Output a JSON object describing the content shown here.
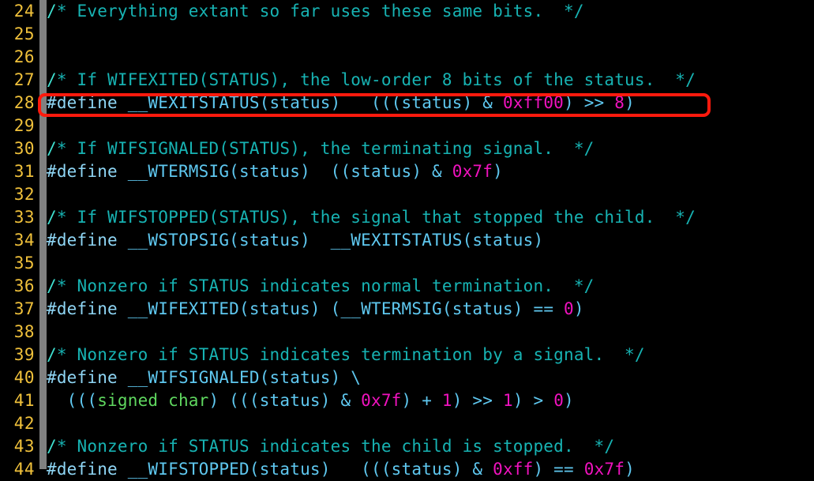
{
  "editor": {
    "background_color": "#000000",
    "gutter_bar_color": "#808080",
    "lineno_color": "#f0c13b",
    "comment_color": "#17b3b3",
    "identifier_color": "#5fc8f0",
    "number_color": "#f012be",
    "type_color": "#5fd75f",
    "preproc_color": "#8fd6f5",
    "highlight_color": "#ff1a0d"
  },
  "highlight": {
    "line_number": "28",
    "text": "#define __WEXITSTATUS(status)   (((status) & 0xff00) >> 8)"
  },
  "lines": [
    {
      "number": "24",
      "text": "/* Everything extant so far uses these same bits.  */",
      "tokens": [
        {
          "t": "/",
          "c": "tok-slash"
        },
        {
          "t": "* Everything extant so far uses these same bits.  */",
          "c": "tok-comment"
        }
      ]
    },
    {
      "number": "25",
      "text": "",
      "tokens": []
    },
    {
      "number": "26",
      "text": "",
      "tokens": []
    },
    {
      "number": "27",
      "text": "/* If WIFEXITED(STATUS), the low-order 8 bits of the status.  */",
      "tokens": [
        {
          "t": "/",
          "c": "tok-slash"
        },
        {
          "t": "* If WIFEXITED(STATUS), the low-order 8 bits of the status.  */",
          "c": "tok-comment"
        }
      ]
    },
    {
      "number": "28",
      "text": "#define __WEXITSTATUS(status)   (((status) & 0xff00) >> 8)",
      "tokens": [
        {
          "t": "#define",
          "c": "tok-pre"
        },
        {
          "t": " __WEXITSTATUS(status)   (((status) & ",
          "c": "tok-ident"
        },
        {
          "t": "0xff00",
          "c": "tok-num"
        },
        {
          "t": ") >> ",
          "c": "tok-ident"
        },
        {
          "t": "8",
          "c": "tok-num"
        },
        {
          "t": ")",
          "c": "tok-ident"
        }
      ]
    },
    {
      "number": "29",
      "text": "",
      "tokens": []
    },
    {
      "number": "30",
      "text": "/* If WIFSIGNALED(STATUS), the terminating signal.  */",
      "tokens": [
        {
          "t": "/",
          "c": "tok-slash"
        },
        {
          "t": "* If WIFSIGNALED(STATUS), the terminating signal.  */",
          "c": "tok-comment"
        }
      ]
    },
    {
      "number": "31",
      "text": "#define __WTERMSIG(status)  ((status) & 0x7f)",
      "tokens": [
        {
          "t": "#define",
          "c": "tok-pre"
        },
        {
          "t": " __WTERMSIG(status)  ((status) & ",
          "c": "tok-ident"
        },
        {
          "t": "0x7f",
          "c": "tok-num"
        },
        {
          "t": ")",
          "c": "tok-ident"
        }
      ]
    },
    {
      "number": "32",
      "text": "",
      "tokens": []
    },
    {
      "number": "33",
      "text": "/* If WIFSTOPPED(STATUS), the signal that stopped the child.  */",
      "tokens": [
        {
          "t": "/",
          "c": "tok-slash"
        },
        {
          "t": "* If WIFSTOPPED(STATUS), the signal that stopped the child.  */",
          "c": "tok-comment"
        }
      ]
    },
    {
      "number": "34",
      "text": "#define __WSTOPSIG(status)  __WEXITSTATUS(status)",
      "tokens": [
        {
          "t": "#define",
          "c": "tok-pre"
        },
        {
          "t": " __WSTOPSIG(status)  __WEXITSTATUS(status)",
          "c": "tok-ident"
        }
      ]
    },
    {
      "number": "35",
      "text": "",
      "tokens": []
    },
    {
      "number": "36",
      "text": "/* Nonzero if STATUS indicates normal termination.  */",
      "tokens": [
        {
          "t": "/",
          "c": "tok-slash"
        },
        {
          "t": "* Nonzero if STATUS indicates normal termination.  */",
          "c": "tok-comment"
        }
      ]
    },
    {
      "number": "37",
      "text": "#define __WIFEXITED(status) (__WTERMSIG(status) == 0)",
      "tokens": [
        {
          "t": "#define",
          "c": "tok-pre"
        },
        {
          "t": " __WIFEXITED(status) (__WTERMSIG(status) == ",
          "c": "tok-ident"
        },
        {
          "t": "0",
          "c": "tok-num"
        },
        {
          "t": ")",
          "c": "tok-ident"
        }
      ]
    },
    {
      "number": "38",
      "text": "",
      "tokens": []
    },
    {
      "number": "39",
      "text": "/* Nonzero if STATUS indicates termination by a signal.  */",
      "tokens": [
        {
          "t": "/",
          "c": "tok-slash"
        },
        {
          "t": "* Nonzero if STATUS indicates termination by a signal.  */",
          "c": "tok-comment"
        }
      ]
    },
    {
      "number": "40",
      "text": "#define __WIFSIGNALED(status) \\",
      "tokens": [
        {
          "t": "#define",
          "c": "tok-pre"
        },
        {
          "t": " __WIFSIGNALED(status) \\",
          "c": "tok-ident"
        }
      ]
    },
    {
      "number": "41",
      "text": "  (((signed char) (((status) & 0x7f) + 1) >> 1) > 0)",
      "tokens": [
        {
          "t": "  (((",
          "c": "tok-ident"
        },
        {
          "t": "signed char",
          "c": "tok-type"
        },
        {
          "t": ") (((status) & ",
          "c": "tok-ident"
        },
        {
          "t": "0x7f",
          "c": "tok-num"
        },
        {
          "t": ") + ",
          "c": "tok-ident"
        },
        {
          "t": "1",
          "c": "tok-num"
        },
        {
          "t": ") >> ",
          "c": "tok-ident"
        },
        {
          "t": "1",
          "c": "tok-num"
        },
        {
          "t": ") > ",
          "c": "tok-ident"
        },
        {
          "t": "0",
          "c": "tok-num"
        },
        {
          "t": ")",
          "c": "tok-ident"
        }
      ]
    },
    {
      "number": "42",
      "text": "",
      "tokens": []
    },
    {
      "number": "43",
      "text": "/* Nonzero if STATUS indicates the child is stopped.  */",
      "tokens": [
        {
          "t": "/",
          "c": "tok-slash"
        },
        {
          "t": "* Nonzero if STATUS indicates the child is stopped.  */",
          "c": "tok-comment"
        }
      ]
    },
    {
      "number": "44",
      "text": "#define __WIFSTOPPED(status)   (((status) & 0xff) == 0x7f)",
      "tokens": [
        {
          "t": "#define",
          "c": "tok-pre"
        },
        {
          "t": " __WIFSTOPPED(status)   (((status) & ",
          "c": "tok-ident"
        },
        {
          "t": "0xff",
          "c": "tok-num"
        },
        {
          "t": ") == ",
          "c": "tok-ident"
        },
        {
          "t": "0x7f",
          "c": "tok-num"
        },
        {
          "t": ")",
          "c": "tok-ident"
        }
      ]
    }
  ]
}
